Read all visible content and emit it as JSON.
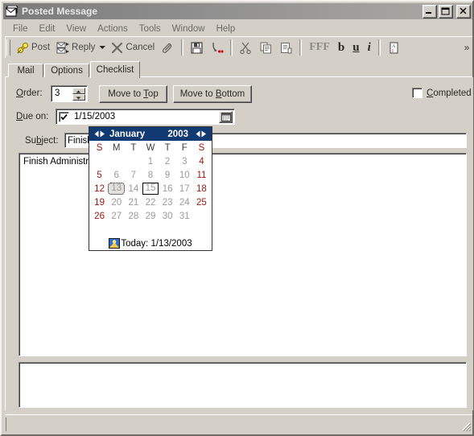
{
  "window": {
    "title": "Posted Message",
    "icon": "posted-message-icon",
    "controls": {
      "minimize": "Minimize",
      "maximize": "Maximize",
      "close": "Close"
    }
  },
  "menubar": {
    "items": [
      {
        "label": "File"
      },
      {
        "label": "Edit"
      },
      {
        "label": "View"
      },
      {
        "label": "Actions"
      },
      {
        "label": "Tools"
      },
      {
        "label": "Window"
      },
      {
        "label": "Help"
      }
    ]
  },
  "toolbar": {
    "post_label": "Post",
    "reply_label": "Reply",
    "cancel_label": "Cancel",
    "attach_icon": "paperclip-icon",
    "save_icon": "floppy-disk-icon",
    "checkspelling_icon": "check-names-icon",
    "cut_icon": "scissors-icon",
    "copy_icon": "copy-icon",
    "paste_icon": "paste-icon",
    "font_label": "FFF",
    "bold_label": "b",
    "underline_label": "u",
    "italic_label": "i",
    "spellcheck_icon": "spellcheck-icon",
    "overflow_label": "»"
  },
  "tabs": [
    {
      "label": "Mail",
      "active": false
    },
    {
      "label": "Options",
      "active": false
    },
    {
      "label": "Checklist",
      "active": true
    }
  ],
  "checklist": {
    "order_label": "Order:",
    "order_label_pre": "O",
    "order_label_post": "rder:",
    "order_value": "3",
    "move_to_top": {
      "pre": "Move to ",
      "accel": "T",
      "post": "op"
    },
    "move_to_bottom": {
      "pre": "Move to ",
      "accel": "B",
      "post": "ottom"
    },
    "completed": {
      "pre": "",
      "accel": "C",
      "post": "ompleted",
      "checked": false
    },
    "due_on": {
      "pre": "D",
      "accel": "",
      "label_a": "D",
      "label_b": "ue on:",
      "checked": true,
      "value": "1/15/2003"
    },
    "subject": {
      "label_a": "Su",
      "label_b": "b",
      "label_c": "ject:",
      "value": "Finish Administrative Paperwork"
    },
    "body_text": "Finish Administrative Paperwork"
  },
  "calendar": {
    "month": "January",
    "year": "2003",
    "prev_icon": "prev-arrows-icon",
    "next_icon": "next-arrows-icon",
    "day_headers": [
      "S",
      "M",
      "T",
      "W",
      "T",
      "F",
      "S"
    ],
    "weeks": [
      [
        "",
        "",
        "",
        "1",
        "2",
        "3",
        "4"
      ],
      [
        "5",
        "6",
        "7",
        "8",
        "9",
        "10",
        "11"
      ],
      [
        "12",
        "13",
        "14",
        "15",
        "16",
        "17",
        "18"
      ],
      [
        "19",
        "20",
        "21",
        "22",
        "23",
        "24",
        "25"
      ],
      [
        "26",
        "27",
        "28",
        "29",
        "30",
        "31",
        ""
      ]
    ],
    "today_day": "13",
    "selected_day": "15",
    "today_label": "Today: 1/13/2003",
    "today_icon": "today-calendar-icon",
    "header_color": "#123a72",
    "weekend_color": "#99180e",
    "weekday_color": "#9a9a9a"
  },
  "statusbar": {
    "text": "",
    "grip_icon": "resize-grip-icon"
  }
}
